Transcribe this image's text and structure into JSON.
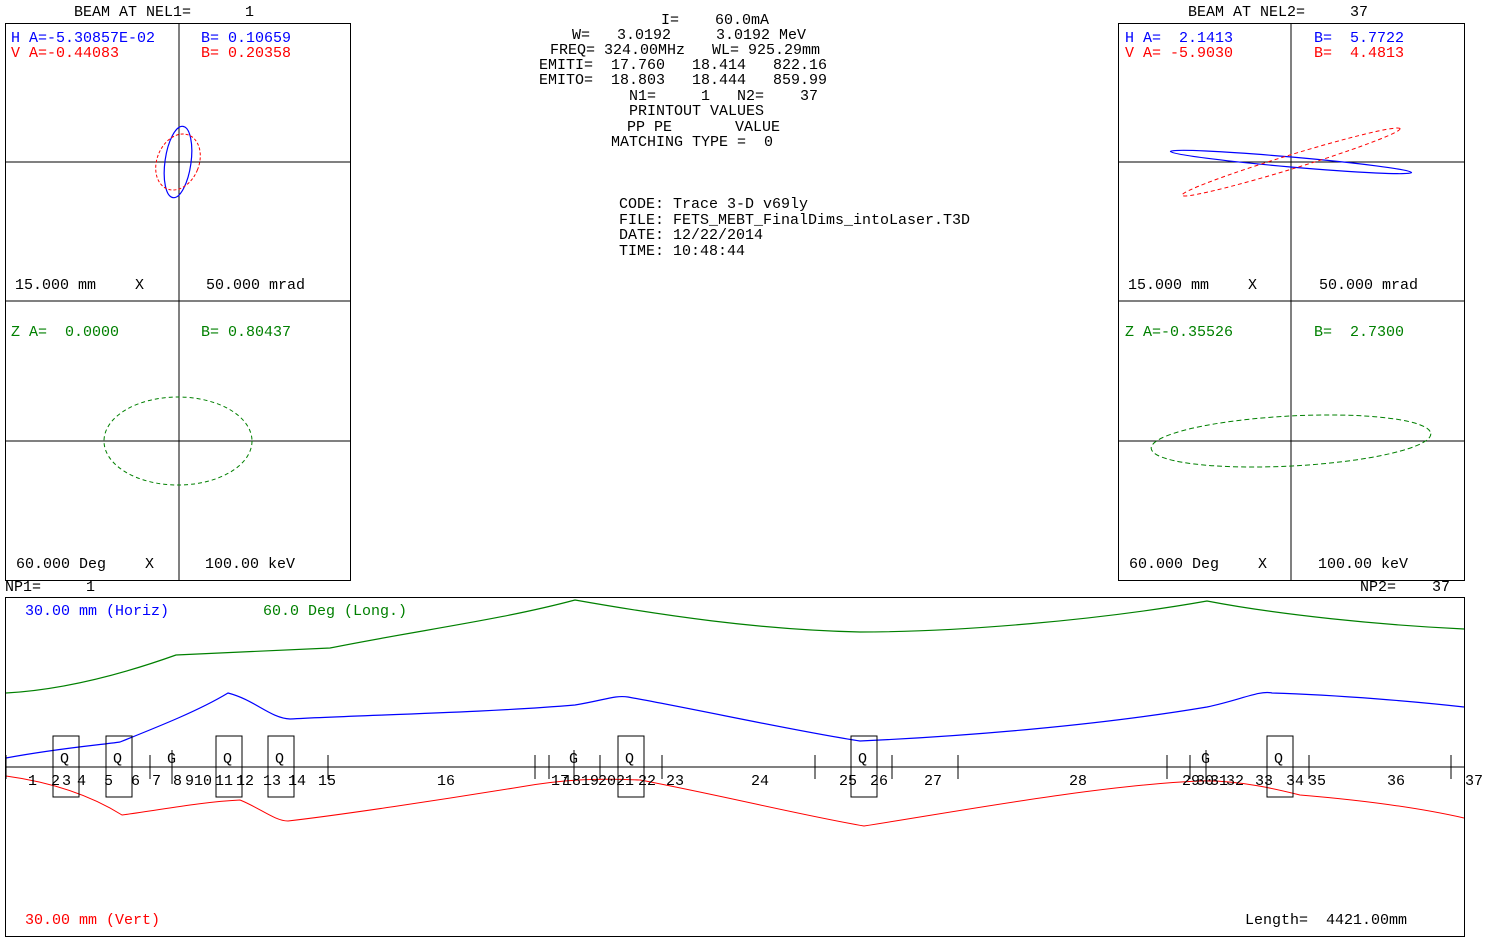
{
  "left_beam": {
    "title": "BEAM AT NEL1=",
    "nel": "1",
    "h_a": "H A=-5.30857E-02",
    "h_b": "B= 0.10659",
    "v_a": "V A=-0.44083",
    "v_b": "B= 0.20358",
    "xscale": "15.000 mm",
    "xaxis": "X",
    "xpscale": "50.000 mrad",
    "z_a": "Z A=  0.0000",
    "z_b": "B= 0.80437",
    "phscale": "60.000 Deg",
    "phaxis": "X",
    "escale": "100.00 keV"
  },
  "right_beam": {
    "title": "BEAM AT NEL2=",
    "nel": "37",
    "h_a": "H A=  2.1413",
    "h_b": "B=  5.7722",
    "v_a": "V A= -5.9030",
    "v_b": "B=  4.4813",
    "xscale": "15.000 mm",
    "xaxis": "X",
    "xpscale": "50.000 mrad",
    "z_a": "Z A=-0.35526",
    "z_b": "B=  2.7300",
    "phscale": "60.000 Deg",
    "phaxis": "X",
    "escale": "100.00 keV"
  },
  "info": {
    "lines": [
      "        I=    60.0mA",
      "W=   3.0192     3.0192 MeV",
      " FREQ= 324.00MHz   WL= 925.29mm",
      "EMITI=  17.760   18.414   822.16",
      "EMITO=  18.803   18.444   859.99",
      "       N1=     1   N2=    37",
      "       PRINTOUT VALUES",
      "        PP PE       VALUE",
      "    MATCHING TYPE =  0"
    ],
    "code_lines": [
      "CODE: Trace 3-D v69ly",
      "FILE: FETS_MEBT_FinalDims_intoLaser.T3D",
      "DATE: 12/22/2014",
      "TIME: 10:48:44"
    ]
  },
  "profile": {
    "np1": "NP1=     1",
    "np2": "NP2=    37",
    "horiz_label": "30.00 mm (Horiz)",
    "long_label": "60.0 Deg (Long.)",
    "vert_label": "30.00 mm (Vert)",
    "length_label": "Length=  4421.00mm",
    "element_numbers": [
      "1",
      "2",
      "3",
      "4",
      "5",
      "6",
      "7",
      "8",
      "9",
      "10",
      "11",
      "12",
      "13",
      "14",
      "15",
      "16",
      "17",
      "18",
      "19",
      "20",
      "21",
      "22",
      "23",
      "24",
      "25",
      "26",
      "27",
      "28",
      "29",
      "30",
      "31",
      "32",
      "33",
      "34",
      "35",
      "36",
      "37"
    ],
    "quad_label": "Q",
    "gap_label": "G"
  },
  "colors": {
    "horizontal": "#0000ff",
    "vertical": "#ff0000",
    "longitudinal": "#008000",
    "axes": "#000000"
  }
}
